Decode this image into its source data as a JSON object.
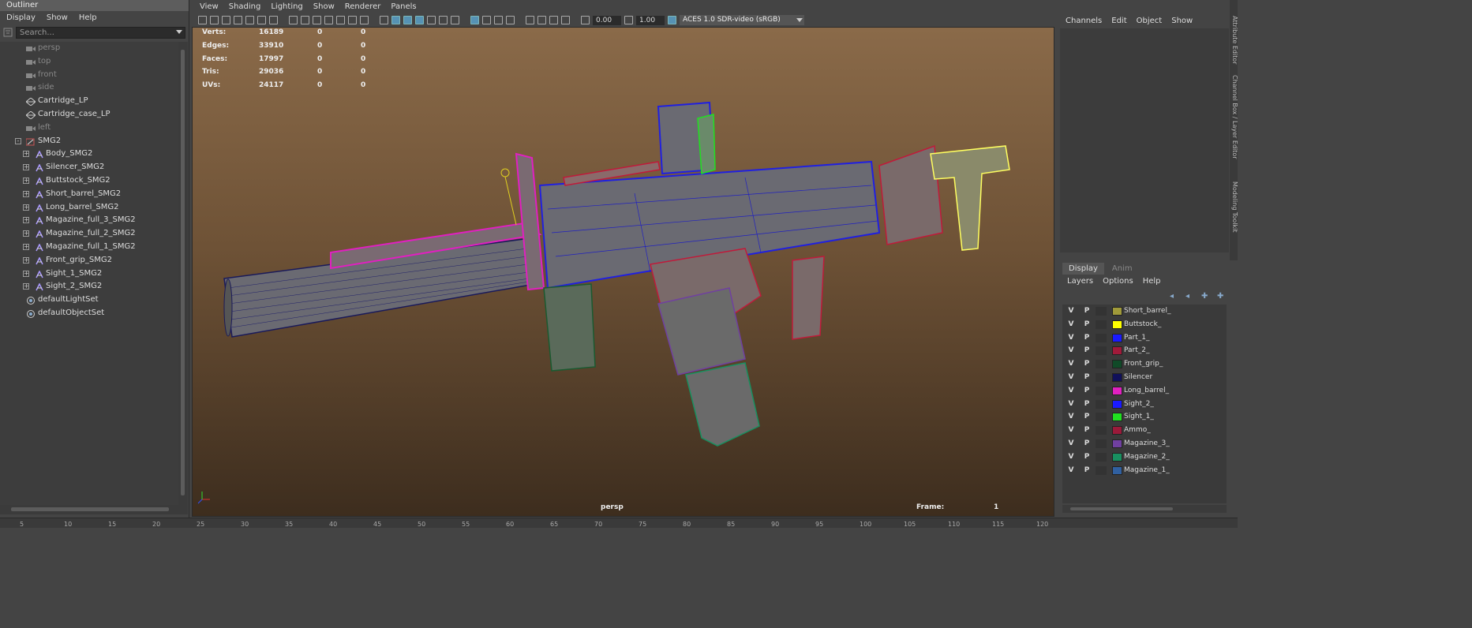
{
  "outliner": {
    "title": "Outliner",
    "menu": [
      "Display",
      "Show",
      "Help"
    ],
    "search_placeholder": "Search...",
    "items": [
      {
        "label": "persp",
        "icon": "camera-icon",
        "indent": 1,
        "dim": true
      },
      {
        "label": "top",
        "icon": "camera-icon",
        "indent": 1,
        "dim": true
      },
      {
        "label": "front",
        "icon": "camera-icon",
        "indent": 1,
        "dim": true
      },
      {
        "label": "side",
        "icon": "camera-icon",
        "indent": 1,
        "dim": true
      },
      {
        "label": "Cartridge_LP",
        "icon": "mesh-icon",
        "indent": 1,
        "dim": false
      },
      {
        "label": "Cartridge_case_LP",
        "icon": "mesh-icon",
        "indent": 1,
        "dim": false
      },
      {
        "label": "left",
        "icon": "camera-icon",
        "indent": 1,
        "dim": true
      },
      {
        "label": "SMG2",
        "icon": "group-icon",
        "indent": 0,
        "dim": false,
        "expander": "-"
      },
      {
        "label": "Body_SMG2",
        "icon": "transform-icon",
        "indent": 2,
        "dim": false,
        "expander": "+"
      },
      {
        "label": "Silencer_SMG2",
        "icon": "transform-icon",
        "indent": 2,
        "dim": false,
        "expander": "+"
      },
      {
        "label": "Buttstock_SMG2",
        "icon": "transform-icon",
        "indent": 2,
        "dim": false,
        "expander": "+"
      },
      {
        "label": "Short_barrel_SMG2",
        "icon": "transform-icon",
        "indent": 2,
        "dim": false,
        "expander": "+"
      },
      {
        "label": "Long_barrel_SMG2",
        "icon": "transform-icon",
        "indent": 2,
        "dim": false,
        "expander": "+"
      },
      {
        "label": "Magazine_full_3_SMG2",
        "icon": "transform-icon",
        "indent": 2,
        "dim": false,
        "expander": "+"
      },
      {
        "label": "Magazine_full_2_SMG2",
        "icon": "transform-icon",
        "indent": 2,
        "dim": false,
        "expander": "+"
      },
      {
        "label": "Magazine_full_1_SMG2",
        "icon": "transform-icon",
        "indent": 2,
        "dim": false,
        "expander": "+"
      },
      {
        "label": "Front_grip_SMG2",
        "icon": "transform-icon",
        "indent": 2,
        "dim": false,
        "expander": "+"
      },
      {
        "label": "Sight_1_SMG2",
        "icon": "transform-icon",
        "indent": 2,
        "dim": false,
        "expander": "+"
      },
      {
        "label": "Sight_2_SMG2",
        "icon": "transform-icon",
        "indent": 2,
        "dim": false,
        "expander": "+"
      },
      {
        "label": "defaultLightSet",
        "icon": "set-icon",
        "indent": 1,
        "dim": false
      },
      {
        "label": "defaultObjectSet",
        "icon": "set-icon",
        "indent": 1,
        "dim": false
      }
    ]
  },
  "viewport": {
    "menu": [
      "View",
      "Shading",
      "Lighting",
      "Show",
      "Renderer",
      "Panels"
    ],
    "exposure": "0.00",
    "gamma": "1.00",
    "color_space": "ACES 1.0 SDR-video (sRGB)",
    "hud": [
      {
        "label": "Verts:",
        "values": [
          "16189",
          "0",
          "0"
        ]
      },
      {
        "label": "Edges:",
        "values": [
          "33910",
          "0",
          "0"
        ]
      },
      {
        "label": "Faces:",
        "values": [
          "17997",
          "0",
          "0"
        ]
      },
      {
        "label": "Tris:",
        "values": [
          "29036",
          "0",
          "0"
        ]
      },
      {
        "label": "UVs:",
        "values": [
          "24117",
          "0",
          "0"
        ]
      }
    ],
    "camera_name": "persp",
    "frame_label": "Frame:",
    "frame_value": "1"
  },
  "channel_box": {
    "menu": [
      "Channels",
      "Edit",
      "Object",
      "Show"
    ],
    "side_tabs": [
      "Attribute Editor",
      "Channel Box / Layer Editor",
      "Modeling Toolkit"
    ]
  },
  "layer_editor": {
    "tabs": [
      "Display",
      "Anim"
    ],
    "menu": [
      "Layers",
      "Options",
      "Help"
    ],
    "layers": [
      {
        "v": "V",
        "p": "P",
        "name": "Short_barrel_",
        "color": "#a09a3a"
      },
      {
        "v": "V",
        "p": "P",
        "name": "Buttstock_",
        "color": "#ffff00"
      },
      {
        "v": "V",
        "p": "P",
        "name": "Part_1_",
        "color": "#1a1aff"
      },
      {
        "v": "V",
        "p": "P",
        "name": "Part_2_",
        "color": "#a01a3a"
      },
      {
        "v": "V",
        "p": "P",
        "name": "Front_grip_",
        "color": "#104a28"
      },
      {
        "v": "V",
        "p": "P",
        "name": "Silencer",
        "color": "#10105a"
      },
      {
        "v": "V",
        "p": "P",
        "name": "Long_barrel_",
        "color": "#e020c0"
      },
      {
        "v": "V",
        "p": "P",
        "name": "Sight_2_",
        "color": "#1a1aff"
      },
      {
        "v": "V",
        "p": "P",
        "name": "Sight_1_",
        "color": "#20e020"
      },
      {
        "v": "V",
        "p": "P",
        "name": "Ammo_",
        "color": "#9a1a3a"
      },
      {
        "v": "V",
        "p": "P",
        "name": "Magazine_3_",
        "color": "#7040a0"
      },
      {
        "v": "V",
        "p": "P",
        "name": "Magazine_2_",
        "color": "#189060"
      },
      {
        "v": "V",
        "p": "P",
        "name": "Magazine_1_",
        "color": "#3060a0"
      }
    ]
  },
  "timeline": {
    "ticks": [
      "5",
      "10",
      "15",
      "20",
      "25",
      "30",
      "35",
      "40",
      "45",
      "50",
      "55",
      "60",
      "65",
      "70",
      "75",
      "80",
      "85",
      "90",
      "95",
      "100",
      "105",
      "110",
      "115",
      "120"
    ]
  }
}
